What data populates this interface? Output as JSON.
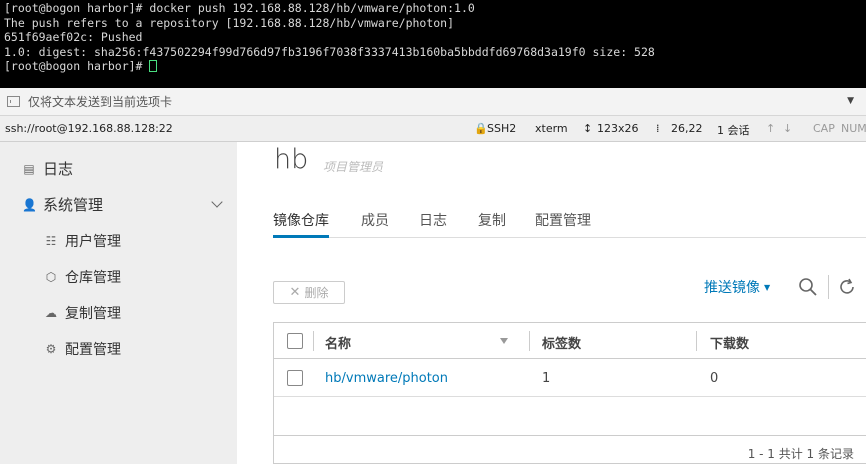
{
  "terminal": {
    "lines": [
      "[root@bogon harbor]# docker push 192.168.88.128/hb/vmware/photon:1.0",
      "The push refers to a repository [192.168.88.128/hb/vmware/photon]",
      "651f69aef02c: Pushed",
      "1.0: digest: sha256:f437502294f99d766d97fb3196f7038f3337413b160ba5bbddfd69768d3a19f0 size: 528"
    ],
    "prompt": "[root@bogon harbor]# "
  },
  "sendbar": {
    "label": "仅将文本发送到当前选项卡",
    "dropdown_icon": "triangle-down"
  },
  "statusbar": {
    "connection": "ssh://root@192.168.88.128:22",
    "protocol": "SSH2",
    "terminal_type": "xterm",
    "size": "123x26",
    "cursor_pos": "26,22",
    "sessions": "1 会话",
    "cap": "CAP",
    "num": "NUM"
  },
  "sidebar": {
    "logs": "日志",
    "system_admin": "系统管理",
    "items": [
      "用户管理",
      "仓库管理",
      "复制管理",
      "配置管理"
    ]
  },
  "project": {
    "name": "hb",
    "role": "项目管理员",
    "tabs": [
      "镜像仓库",
      "成员",
      "日志",
      "复制",
      "配置管理"
    ]
  },
  "toolbar": {
    "delete": "删除",
    "push_image": "推送镜像"
  },
  "table": {
    "columns": [
      "名称",
      "标签数",
      "下载数"
    ],
    "rows": [
      {
        "name": "hb/vmware/photon",
        "tags": "1",
        "pulls": "0"
      }
    ],
    "footer": "1 - 1 共计 1 条记录"
  },
  "colors": {
    "accent": "#0079b8",
    "sidebar_bg": "#eeeeee",
    "terminal_bg": "#000000"
  }
}
